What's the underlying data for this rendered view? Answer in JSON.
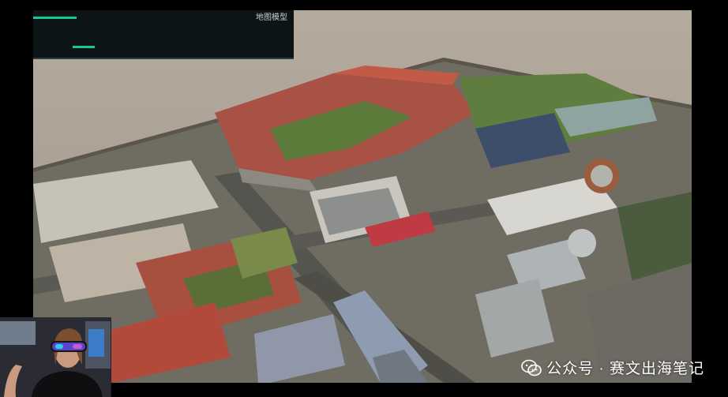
{
  "viewer": {
    "panel_label": "地图模型"
  },
  "watermark": {
    "text": "公众号 · 赛文出海笔记",
    "icon": "wechat-icon"
  },
  "colors": {
    "tabletop": "#b5aa9e",
    "ui_accent": "#11c89a",
    "roof_red": "#b4483a",
    "roof_grey": "#9ea3a6",
    "vegetation": "#4f6b2f"
  }
}
